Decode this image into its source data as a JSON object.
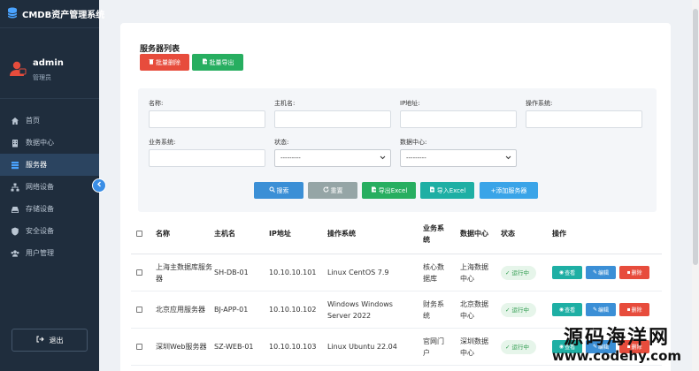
{
  "sidebar": {
    "brand": "CMDB资产管理系统",
    "user": {
      "name": "admin",
      "role": "管理员"
    },
    "menu": [
      {
        "label": "首页",
        "icon": "home-icon",
        "active": false
      },
      {
        "label": "数据中心",
        "icon": "building-icon",
        "active": false
      },
      {
        "label": "服务器",
        "icon": "server-icon",
        "active": true
      },
      {
        "label": "网络设备",
        "icon": "network-icon",
        "active": false
      },
      {
        "label": "存储设备",
        "icon": "storage-icon",
        "active": false
      },
      {
        "label": "安全设备",
        "icon": "shield-icon",
        "active": false
      },
      {
        "label": "用户管理",
        "icon": "users-icon",
        "active": false
      }
    ],
    "logout_label": "退出"
  },
  "page": {
    "title": "服务器列表",
    "batch_delete_label": "批量删除",
    "batch_export_label": "批量导出"
  },
  "filter": {
    "name_label": "名称:",
    "host_label": "主机名:",
    "ip_label": "IP地址:",
    "os_label": "操作系统:",
    "biz_label": "业务系统:",
    "status_label": "状态:",
    "status_value": "---------",
    "dc_label": "数据中心:",
    "dc_value": "---------",
    "search_label": "搜索",
    "reset_label": "重置",
    "export_label": "导出Excel",
    "import_label": "导入Excel",
    "add_label": "+添加服务器"
  },
  "table": {
    "headers": {
      "name": "名称",
      "host": "主机名",
      "ip": "IP地址",
      "os": "操作系统",
      "biz": "业务系统",
      "dc": "数据中心",
      "status": "状态",
      "ops": "操作"
    },
    "rows": [
      {
        "name": "上海主数据库服务器",
        "host": "SH-DB-01",
        "ip": "10.10.10.101",
        "os": "Linux CentOS 7.9",
        "biz": "核心数据库",
        "dc": "上海数据中心",
        "status": "运行中"
      },
      {
        "name": "北京应用服务器",
        "host": "BJ-APP-01",
        "ip": "10.10.10.102",
        "os": "Windows Windows Server 2022",
        "biz": "财务系统",
        "dc": "北京数据中心",
        "status": "运行中"
      },
      {
        "name": "深圳Web服务器",
        "host": "SZ-WEB-01",
        "ip": "10.10.10.103",
        "os": "Linux Ubuntu 22.04",
        "biz": "官网门户",
        "dc": "深圳数据中心",
        "status": "运行中"
      }
    ],
    "ops": {
      "view": "查看",
      "edit": "编辑",
      "delete": "删除"
    }
  },
  "watermark": {
    "line1": "源码海洋网",
    "line2": "www.codehy.com"
  },
  "colors": {
    "sidebar": "#1f2d3d",
    "danger": "#e74c3c",
    "success": "#27ae60",
    "primary": "#3b8fd6",
    "teal": "#1eafa4"
  }
}
